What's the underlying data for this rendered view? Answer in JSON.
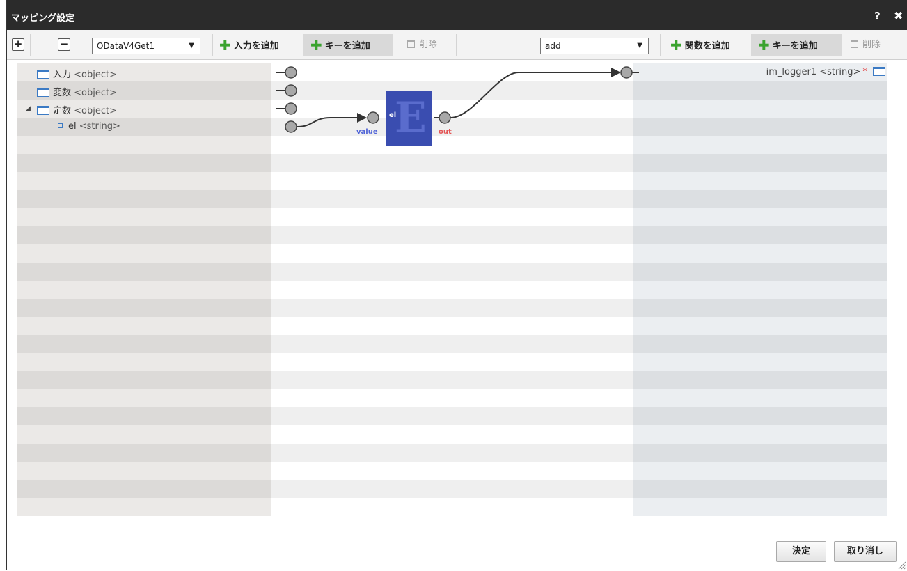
{
  "dialog": {
    "title": "マッピング設定",
    "help": "?",
    "close": "✖"
  },
  "toolbar": {
    "expand": "+",
    "collapse": "−",
    "source_select": "ODataV4Get1",
    "add_input": "入力を追加",
    "add_key_left": "キーを追加",
    "delete_left": "削除",
    "function_select": "add",
    "add_function": "関数を追加",
    "add_key_right": "キーを追加",
    "delete_right": "削除"
  },
  "source_tree": [
    {
      "label": "入力",
      "type": "<object>"
    },
    {
      "label": "変数",
      "type": "<object>"
    },
    {
      "label": "定数",
      "type": "<object>"
    },
    {
      "label": "el",
      "type": "<string>"
    }
  ],
  "function_node": {
    "icon_letter": "E",
    "name": "el",
    "input_port": "value",
    "output_port": "out"
  },
  "target_tree": [
    {
      "label": "im_logger1",
      "type": "<string>",
      "required_mark": "*"
    }
  ],
  "footer": {
    "ok": "決定",
    "cancel": "取り消し"
  },
  "colors": {
    "titlebar": "#2b2b2b",
    "function_box": "#3a4db0",
    "add_icon": "#3aa32e",
    "required": "#e03030",
    "tree_icon": "#3b7ac4"
  }
}
